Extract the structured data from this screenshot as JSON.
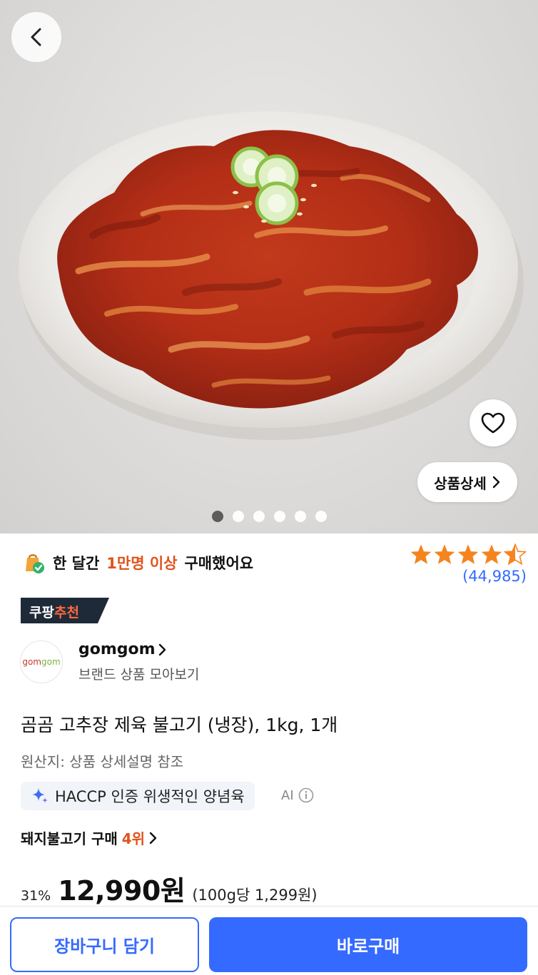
{
  "hero": {
    "image_alt": "",
    "detail_button_label": "상품상세",
    "carousel": {
      "total": 6,
      "active_index": 0
    }
  },
  "purchase_stat": {
    "prefix": "한 달간",
    "highlight": "1만명 이상",
    "suffix": "구매했어요"
  },
  "rating": {
    "stars": 4.5,
    "review_count": "(44,985)"
  },
  "recommend_badge": {
    "brand_part": "쿠팡",
    "accent_part": "추천"
  },
  "brand": {
    "logo_text_a": "gom",
    "logo_text_b": "gom",
    "name": "gomgom",
    "sub_label": "브랜드 상품 모아보기"
  },
  "product": {
    "title": "곰곰 고추장 제육 불고기 (냉장), 1kg, 1개",
    "origin": "원산지: 상품 상세설명 참조",
    "ai_summary": "HACCP 인증 위생적인 양념육",
    "ai_label": "AI"
  },
  "ranking": {
    "category": "돼지불고기 구매",
    "rank": "4위"
  },
  "price": {
    "discount": "31%",
    "amount": "12,990원",
    "unit_price": "(100g당 1,299원)"
  },
  "actions": {
    "cart_label": "장바구니 담기",
    "buy_label": "바로구매"
  },
  "colors": {
    "accent_blue": "#346aff",
    "highlight_orange": "#e0531b",
    "star": "#f5841f"
  },
  "icons": [
    "back-arrow-icon",
    "heart-icon",
    "chevron-right-icon",
    "shopping-bag-check-icon",
    "sparkle-icon",
    "info-icon",
    "star-icon"
  ]
}
